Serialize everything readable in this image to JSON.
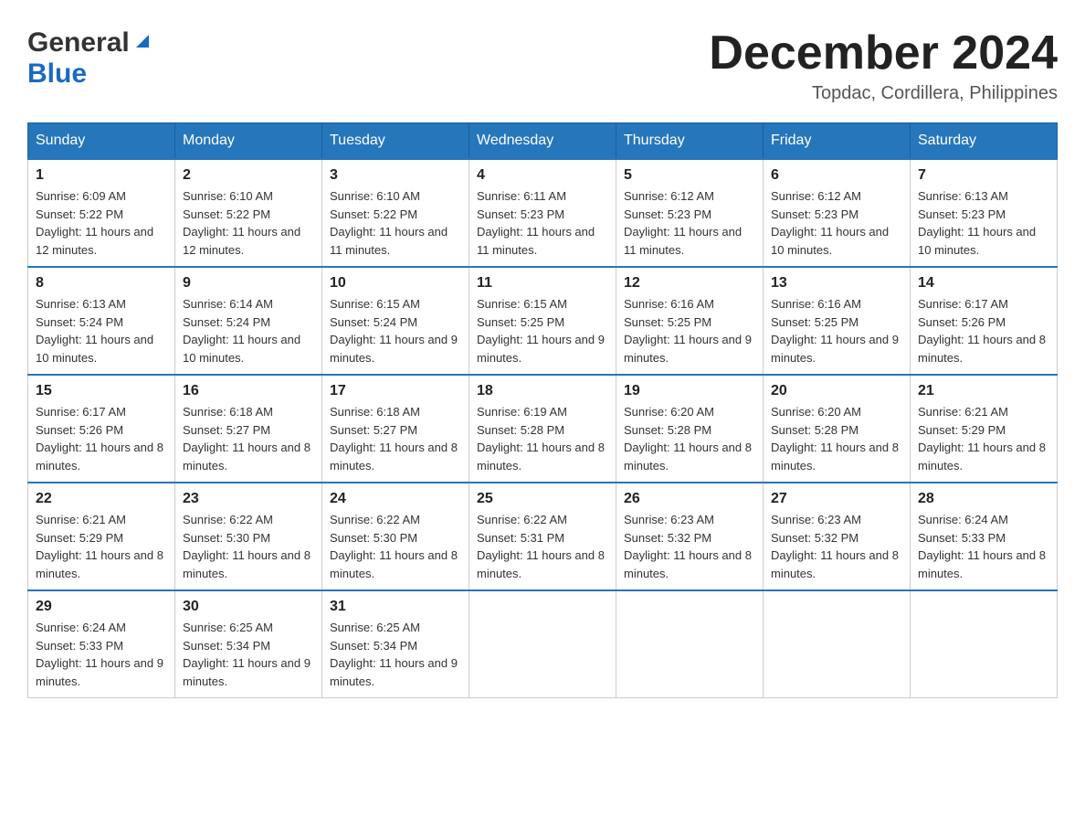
{
  "header": {
    "logo_general": "General",
    "logo_blue": "Blue",
    "month_title": "December 2024",
    "subtitle": "Topdac, Cordillera, Philippines"
  },
  "days_of_week": [
    "Sunday",
    "Monday",
    "Tuesday",
    "Wednesday",
    "Thursday",
    "Friday",
    "Saturday"
  ],
  "weeks": [
    [
      {
        "day": "1",
        "sunrise": "Sunrise: 6:09 AM",
        "sunset": "Sunset: 5:22 PM",
        "daylight": "Daylight: 11 hours and 12 minutes."
      },
      {
        "day": "2",
        "sunrise": "Sunrise: 6:10 AM",
        "sunset": "Sunset: 5:22 PM",
        "daylight": "Daylight: 11 hours and 12 minutes."
      },
      {
        "day": "3",
        "sunrise": "Sunrise: 6:10 AM",
        "sunset": "Sunset: 5:22 PM",
        "daylight": "Daylight: 11 hours and 11 minutes."
      },
      {
        "day": "4",
        "sunrise": "Sunrise: 6:11 AM",
        "sunset": "Sunset: 5:23 PM",
        "daylight": "Daylight: 11 hours and 11 minutes."
      },
      {
        "day": "5",
        "sunrise": "Sunrise: 6:12 AM",
        "sunset": "Sunset: 5:23 PM",
        "daylight": "Daylight: 11 hours and 11 minutes."
      },
      {
        "day": "6",
        "sunrise": "Sunrise: 6:12 AM",
        "sunset": "Sunset: 5:23 PM",
        "daylight": "Daylight: 11 hours and 10 minutes."
      },
      {
        "day": "7",
        "sunrise": "Sunrise: 6:13 AM",
        "sunset": "Sunset: 5:23 PM",
        "daylight": "Daylight: 11 hours and 10 minutes."
      }
    ],
    [
      {
        "day": "8",
        "sunrise": "Sunrise: 6:13 AM",
        "sunset": "Sunset: 5:24 PM",
        "daylight": "Daylight: 11 hours and 10 minutes."
      },
      {
        "day": "9",
        "sunrise": "Sunrise: 6:14 AM",
        "sunset": "Sunset: 5:24 PM",
        "daylight": "Daylight: 11 hours and 10 minutes."
      },
      {
        "day": "10",
        "sunrise": "Sunrise: 6:15 AM",
        "sunset": "Sunset: 5:24 PM",
        "daylight": "Daylight: 11 hours and 9 minutes."
      },
      {
        "day": "11",
        "sunrise": "Sunrise: 6:15 AM",
        "sunset": "Sunset: 5:25 PM",
        "daylight": "Daylight: 11 hours and 9 minutes."
      },
      {
        "day": "12",
        "sunrise": "Sunrise: 6:16 AM",
        "sunset": "Sunset: 5:25 PM",
        "daylight": "Daylight: 11 hours and 9 minutes."
      },
      {
        "day": "13",
        "sunrise": "Sunrise: 6:16 AM",
        "sunset": "Sunset: 5:25 PM",
        "daylight": "Daylight: 11 hours and 9 minutes."
      },
      {
        "day": "14",
        "sunrise": "Sunrise: 6:17 AM",
        "sunset": "Sunset: 5:26 PM",
        "daylight": "Daylight: 11 hours and 8 minutes."
      }
    ],
    [
      {
        "day": "15",
        "sunrise": "Sunrise: 6:17 AM",
        "sunset": "Sunset: 5:26 PM",
        "daylight": "Daylight: 11 hours and 8 minutes."
      },
      {
        "day": "16",
        "sunrise": "Sunrise: 6:18 AM",
        "sunset": "Sunset: 5:27 PM",
        "daylight": "Daylight: 11 hours and 8 minutes."
      },
      {
        "day": "17",
        "sunrise": "Sunrise: 6:18 AM",
        "sunset": "Sunset: 5:27 PM",
        "daylight": "Daylight: 11 hours and 8 minutes."
      },
      {
        "day": "18",
        "sunrise": "Sunrise: 6:19 AM",
        "sunset": "Sunset: 5:28 PM",
        "daylight": "Daylight: 11 hours and 8 minutes."
      },
      {
        "day": "19",
        "sunrise": "Sunrise: 6:20 AM",
        "sunset": "Sunset: 5:28 PM",
        "daylight": "Daylight: 11 hours and 8 minutes."
      },
      {
        "day": "20",
        "sunrise": "Sunrise: 6:20 AM",
        "sunset": "Sunset: 5:28 PM",
        "daylight": "Daylight: 11 hours and 8 minutes."
      },
      {
        "day": "21",
        "sunrise": "Sunrise: 6:21 AM",
        "sunset": "Sunset: 5:29 PM",
        "daylight": "Daylight: 11 hours and 8 minutes."
      }
    ],
    [
      {
        "day": "22",
        "sunrise": "Sunrise: 6:21 AM",
        "sunset": "Sunset: 5:29 PM",
        "daylight": "Daylight: 11 hours and 8 minutes."
      },
      {
        "day": "23",
        "sunrise": "Sunrise: 6:22 AM",
        "sunset": "Sunset: 5:30 PM",
        "daylight": "Daylight: 11 hours and 8 minutes."
      },
      {
        "day": "24",
        "sunrise": "Sunrise: 6:22 AM",
        "sunset": "Sunset: 5:30 PM",
        "daylight": "Daylight: 11 hours and 8 minutes."
      },
      {
        "day": "25",
        "sunrise": "Sunrise: 6:22 AM",
        "sunset": "Sunset: 5:31 PM",
        "daylight": "Daylight: 11 hours and 8 minutes."
      },
      {
        "day": "26",
        "sunrise": "Sunrise: 6:23 AM",
        "sunset": "Sunset: 5:32 PM",
        "daylight": "Daylight: 11 hours and 8 minutes."
      },
      {
        "day": "27",
        "sunrise": "Sunrise: 6:23 AM",
        "sunset": "Sunset: 5:32 PM",
        "daylight": "Daylight: 11 hours and 8 minutes."
      },
      {
        "day": "28",
        "sunrise": "Sunrise: 6:24 AM",
        "sunset": "Sunset: 5:33 PM",
        "daylight": "Daylight: 11 hours and 8 minutes."
      }
    ],
    [
      {
        "day": "29",
        "sunrise": "Sunrise: 6:24 AM",
        "sunset": "Sunset: 5:33 PM",
        "daylight": "Daylight: 11 hours and 9 minutes."
      },
      {
        "day": "30",
        "sunrise": "Sunrise: 6:25 AM",
        "sunset": "Sunset: 5:34 PM",
        "daylight": "Daylight: 11 hours and 9 minutes."
      },
      {
        "day": "31",
        "sunrise": "Sunrise: 6:25 AM",
        "sunset": "Sunset: 5:34 PM",
        "daylight": "Daylight: 11 hours and 9 minutes."
      },
      null,
      null,
      null,
      null
    ]
  ]
}
